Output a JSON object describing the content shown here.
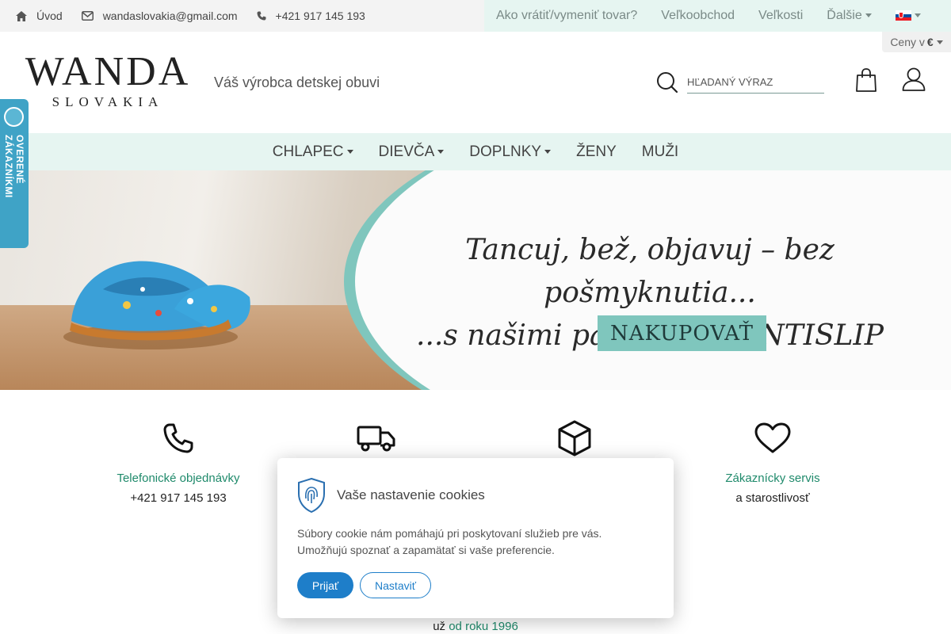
{
  "topbar": {
    "home_label": "Úvod",
    "email": "wandaslovakia@gmail.com",
    "phone": "+421 917 145 193",
    "links": [
      "Ako vrátiť/vymeniť tovar?",
      "Veľkoobchod",
      "Veľkosti",
      "Ďalšie"
    ]
  },
  "currency": {
    "label": "Ceny v",
    "symbol": "€"
  },
  "header": {
    "logo_word": "WANDA",
    "logo_sub": "SLOVAKIA",
    "tagline": "Váš výrobca detskej obuvi",
    "search_placeholder": "HĽADANÝ VÝRAZ"
  },
  "categories": [
    "CHLAPEC",
    "DIEVČA",
    "DOPLNKY",
    "ŽENY",
    "MUŽI"
  ],
  "banner": {
    "line1": "Tancuj, bež, objavuj – bez pošmyknutia...",
    "line2": "...s našimi papučkami ANTISLIP",
    "cta": "NAKUPOVAŤ"
  },
  "verified_badge": "OVERENÉ ZÁKAZNÍKMI",
  "features": [
    {
      "icon": "phone-icon",
      "title": "Telefonické objednávky",
      "subtitle": "+421 917 145 193"
    },
    {
      "icon": "truck-icon",
      "title": "",
      "subtitle": ""
    },
    {
      "icon": "box-icon",
      "title": "",
      "subtitle": ""
    },
    {
      "icon": "heart-icon",
      "title": "Zákaznícky servis",
      "subtitle": "a starostlivosť"
    }
  ],
  "since": {
    "prefix": "už",
    "highlight": "od roku 1996"
  },
  "cookie": {
    "title": "Vaše nastavenie cookies",
    "text": "Súbory cookie nám pomáhajú pri poskytovaní služieb pre vás. Umožňujú spoznať a zapamätať si vaše preferencie.",
    "accept": "Prijať",
    "settings": "Nastaviť"
  },
  "colors": {
    "accent": "#1f8a6b",
    "mint": "#e6f5f1",
    "teal": "#7fc6bd",
    "button_blue": "#1e7ec9"
  }
}
